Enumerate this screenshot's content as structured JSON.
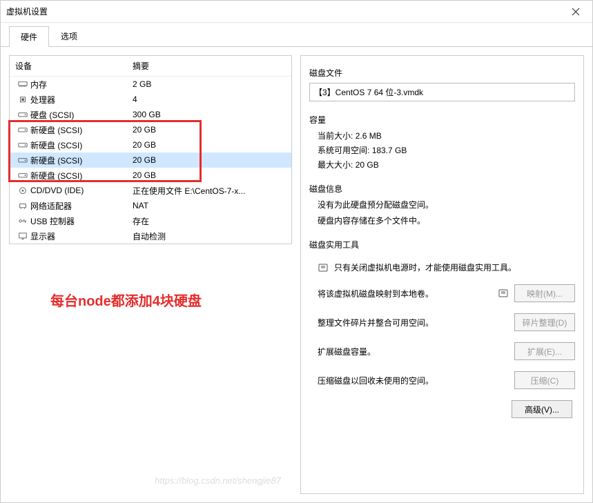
{
  "window": {
    "title": "虚拟机设置"
  },
  "tabs": [
    {
      "label": "硬件",
      "active": true
    },
    {
      "label": "选项",
      "active": false
    }
  ],
  "hw_header": {
    "device": "设备",
    "summary": "摘要"
  },
  "hardware": [
    {
      "icon": "memory",
      "device": "内存",
      "summary": "2 GB",
      "selected": false
    },
    {
      "icon": "cpu",
      "device": "处理器",
      "summary": "4",
      "selected": false
    },
    {
      "icon": "disk",
      "device": "硬盘 (SCSI)",
      "summary": "300 GB",
      "selected": false
    },
    {
      "icon": "disk",
      "device": "新硬盘 (SCSI)",
      "summary": "20 GB",
      "selected": false
    },
    {
      "icon": "disk",
      "device": "新硬盘 (SCSI)",
      "summary": "20 GB",
      "selected": false
    },
    {
      "icon": "disk",
      "device": "新硬盘 (SCSI)",
      "summary": "20 GB",
      "selected": true
    },
    {
      "icon": "disk",
      "device": "新硬盘 (SCSI)",
      "summary": "20 GB",
      "selected": false
    },
    {
      "icon": "cd",
      "device": "CD/DVD (IDE)",
      "summary": "正在使用文件 E:\\CentOS-7-x...",
      "selected": false
    },
    {
      "icon": "network",
      "device": "网络适配器",
      "summary": "NAT",
      "selected": false
    },
    {
      "icon": "usb",
      "device": "USB 控制器",
      "summary": "存在",
      "selected": false
    },
    {
      "icon": "display",
      "device": "显示器",
      "summary": "自动检测",
      "selected": false
    }
  ],
  "annotation": "每台node都添加4块硬盘",
  "right": {
    "disk_file_title": "磁盘文件",
    "disk_file_value": "【3】CentOS 7 64 位-3.vmdk",
    "capacity_title": "容量",
    "current_size_label": "当前大小:",
    "current_size_value": "2.6 MB",
    "free_space_label": "系统可用空间:",
    "free_space_value": "183.7 GB",
    "max_size_label": "最大大小:",
    "max_size_value": "20 GB",
    "disk_info_title": "磁盘信息",
    "disk_info_line1": "没有为此硬盘预分配磁盘空间。",
    "disk_info_line2": "硬盘内容存储在多个文件中。",
    "utilities_title": "磁盘实用工具",
    "util_warning": "只有关闭虚拟机电源时，才能使用磁盘实用工具。",
    "util_map_text": "将该虚拟机磁盘映射到本地卷。",
    "util_map_btn": "映射(M)...",
    "util_defrag_text": "整理文件碎片并整合可用空间。",
    "util_defrag_btn": "碎片整理(D)",
    "util_expand_text": "扩展磁盘容量。",
    "util_expand_btn": "扩展(E)...",
    "util_compress_text": "压缩磁盘以回收未使用的空间。",
    "util_compress_btn": "压缩(C)",
    "advanced_btn": "高级(V)..."
  },
  "watermark": "https://blog.csdn.net/shengjie87"
}
